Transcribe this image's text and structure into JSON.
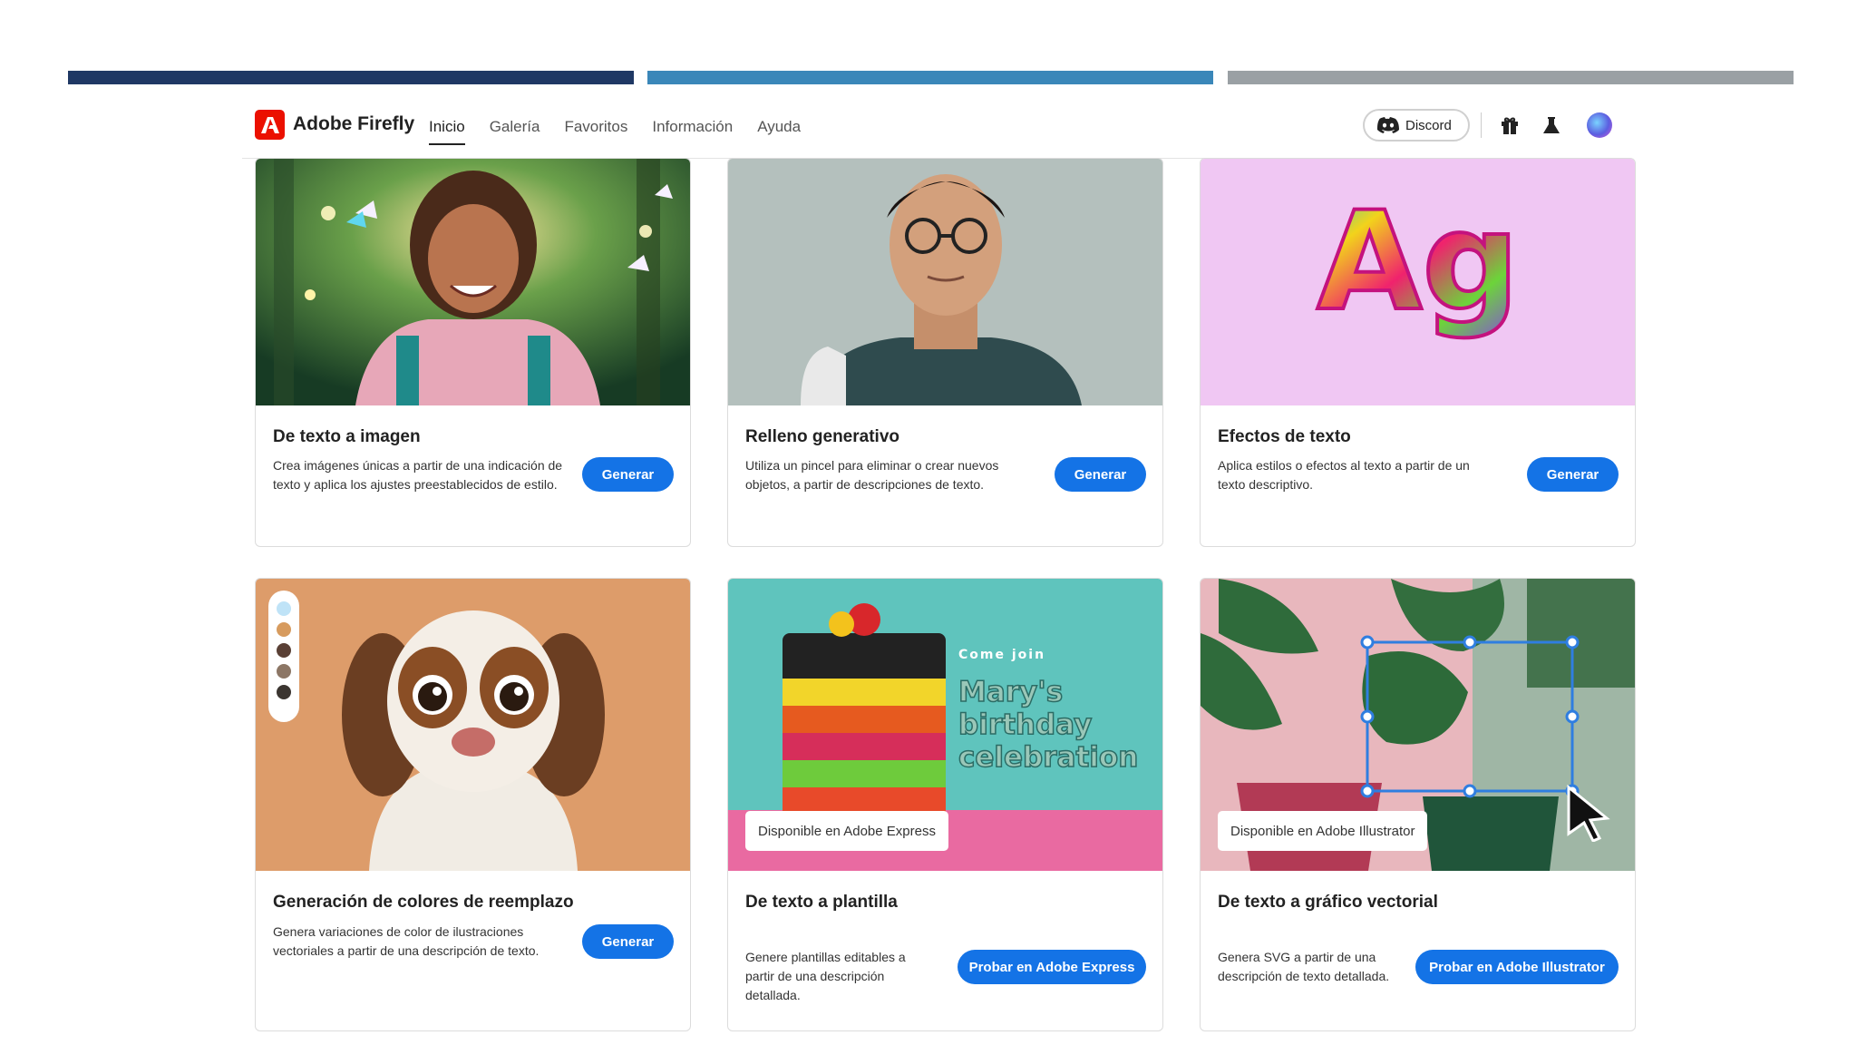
{
  "app": {
    "brand": "Adobe Firefly"
  },
  "nav": [
    {
      "label": "Inicio",
      "active": true
    },
    {
      "label": "Galería"
    },
    {
      "label": "Favoritos"
    },
    {
      "label": "Información"
    },
    {
      "label": "Ayuda"
    }
  ],
  "header": {
    "discord_label": "Discord"
  },
  "cards": [
    {
      "title": "De texto a imagen",
      "description": "Crea imágenes únicas a partir de una indicación de texto y aplica los ajustes preestablecidos de estilo.",
      "button": "Generar"
    },
    {
      "title": "Relleno generativo",
      "description": "Utiliza un pincel para eliminar o crear nuevos objetos, a partir de descripciones de texto.",
      "button": "Generar"
    },
    {
      "title": "Efectos de texto",
      "description": "Aplica estilos o efectos al texto a partir de un texto descriptivo.",
      "button": "Generar",
      "thumb_text": "Ag"
    },
    {
      "title": "Generación de colores de reemplazo",
      "description": "Genera variaciones de color de ilustraciones vectoriales a partir de una descripción de texto.",
      "button": "Generar"
    },
    {
      "title": "De texto a plantilla",
      "description": "Genere plantillas editables a partir de una descripción detallada.",
      "button": "Probar en Adobe Express",
      "badge": "Disponible en Adobe Express",
      "thumb_small": "Come join",
      "thumb_big": [
        "Mary's",
        "birthday",
        "celebration"
      ]
    },
    {
      "title": "De texto a gráfico vectorial",
      "description": "Genera SVG a partir de una descripción de texto detallada.",
      "button": "Probar en Adobe Illustrator",
      "badge": "Disponible en Adobe Illustrator"
    }
  ],
  "colors": {
    "accent": "#1473e6",
    "brand": "#eb1000",
    "bar_navy": "#1f3864",
    "bar_blue": "#3a87b9",
    "bar_gray": "#9aa0a4"
  }
}
